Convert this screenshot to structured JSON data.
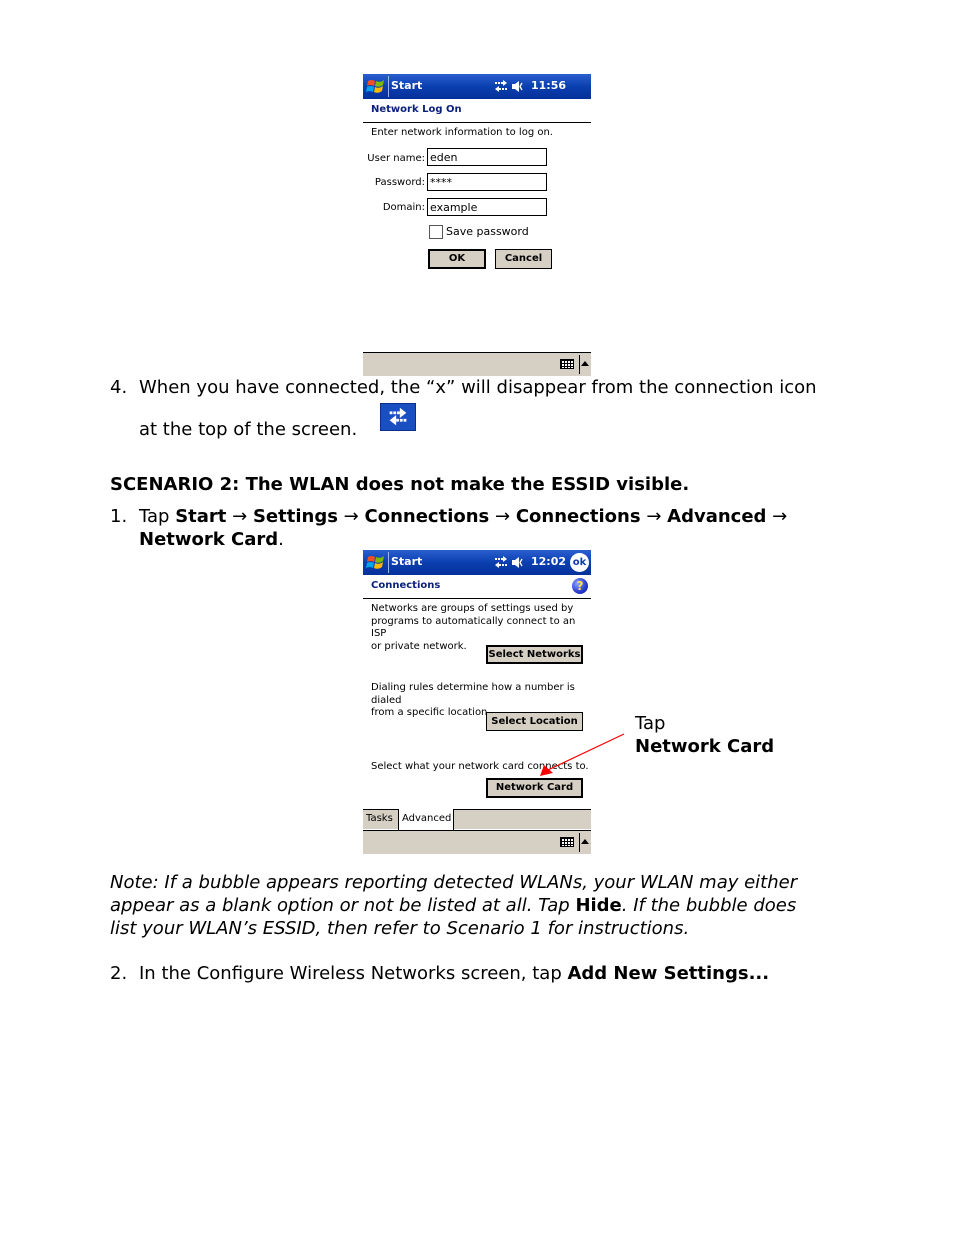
{
  "screen1": {
    "title_bar": {
      "start_label": "Start",
      "time": "11:56",
      "icons": [
        "windows-logo-icon",
        "connection-icon",
        "speaker-icon"
      ]
    },
    "pane_title": "Network Log On",
    "instruction": "Enter network information to log on.",
    "fields": [
      {
        "label": "User name:",
        "value": "eden"
      },
      {
        "label": "Password:",
        "value": "****"
      },
      {
        "label": "Domain:",
        "value": "example"
      }
    ],
    "save_password": {
      "label": "Save password",
      "checked": false
    },
    "buttons": {
      "ok": "OK",
      "cancel": "Cancel"
    },
    "bottom_bar_icons": [
      "keyboard-icon",
      "input-menu-arrow-icon"
    ]
  },
  "step4": {
    "number": "4.",
    "line1": "When you have connected, the “x” will disappear from the connection icon",
    "line2": "at the top of the screen.",
    "icon": "connection-icon"
  },
  "scenario2": {
    "heading": "SCENARIO 2: The WLAN does not make the ESSID visible.",
    "step1": {
      "number": "1.",
      "prefix": "Tap ",
      "path": [
        "Start",
        "Settings",
        "Connections",
        "Connections",
        "Advanced",
        "Network Card"
      ],
      "arrow": "→",
      "suffix": "."
    }
  },
  "screen2": {
    "title_bar": {
      "start_label": "Start",
      "time": "12:02",
      "ok_label": "ok",
      "icons": [
        "windows-logo-icon",
        "connection-icon",
        "speaker-icon",
        "ok-icon"
      ]
    },
    "pane_title": "Connections",
    "help_icon": "?",
    "sections": [
      {
        "text_lines": [
          "Networks are groups of settings used by",
          "programs to automatically connect to an ISP",
          "or private network."
        ],
        "button": "Select Networks"
      },
      {
        "text_lines": [
          "Dialing rules determine how a number is dialed",
          "from a specific location."
        ],
        "button": "Select Location"
      },
      {
        "text_lines": [
          "Select what your network card connects to."
        ],
        "button": "Network Card"
      }
    ],
    "tabs": [
      {
        "label": "Tasks",
        "active": false
      },
      {
        "label": "Advanced",
        "active": true
      }
    ]
  },
  "callout": {
    "line1": "Tap",
    "line2": "Network Card",
    "color": "#ff0000"
  },
  "note": {
    "part1": "Note: If a bubble appears reporting detected WLANs, your WLAN may either",
    "part2a": "appear as a blank option or not be listed at all. Tap ",
    "part2b": "Hide",
    "part2c": ". If the bubble does",
    "part3": "list your WLAN’s ESSID, then refer to Scenario 1 for instructions."
  },
  "step2": {
    "number": "2.",
    "text": "In the Configure Wireless Networks screen, tap ",
    "bold": "Add New Settings..."
  }
}
